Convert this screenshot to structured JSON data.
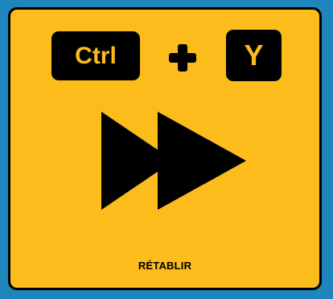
{
  "colors": {
    "background": "#1f85bd",
    "card": "#fbbc1c",
    "ink": "#000000"
  },
  "shortcut": {
    "key1": "Ctrl",
    "key2": "Y",
    "separator_icon": "plus-icon"
  },
  "action": {
    "icon": "fast-forward-icon",
    "label": "RÉTABLIR"
  }
}
